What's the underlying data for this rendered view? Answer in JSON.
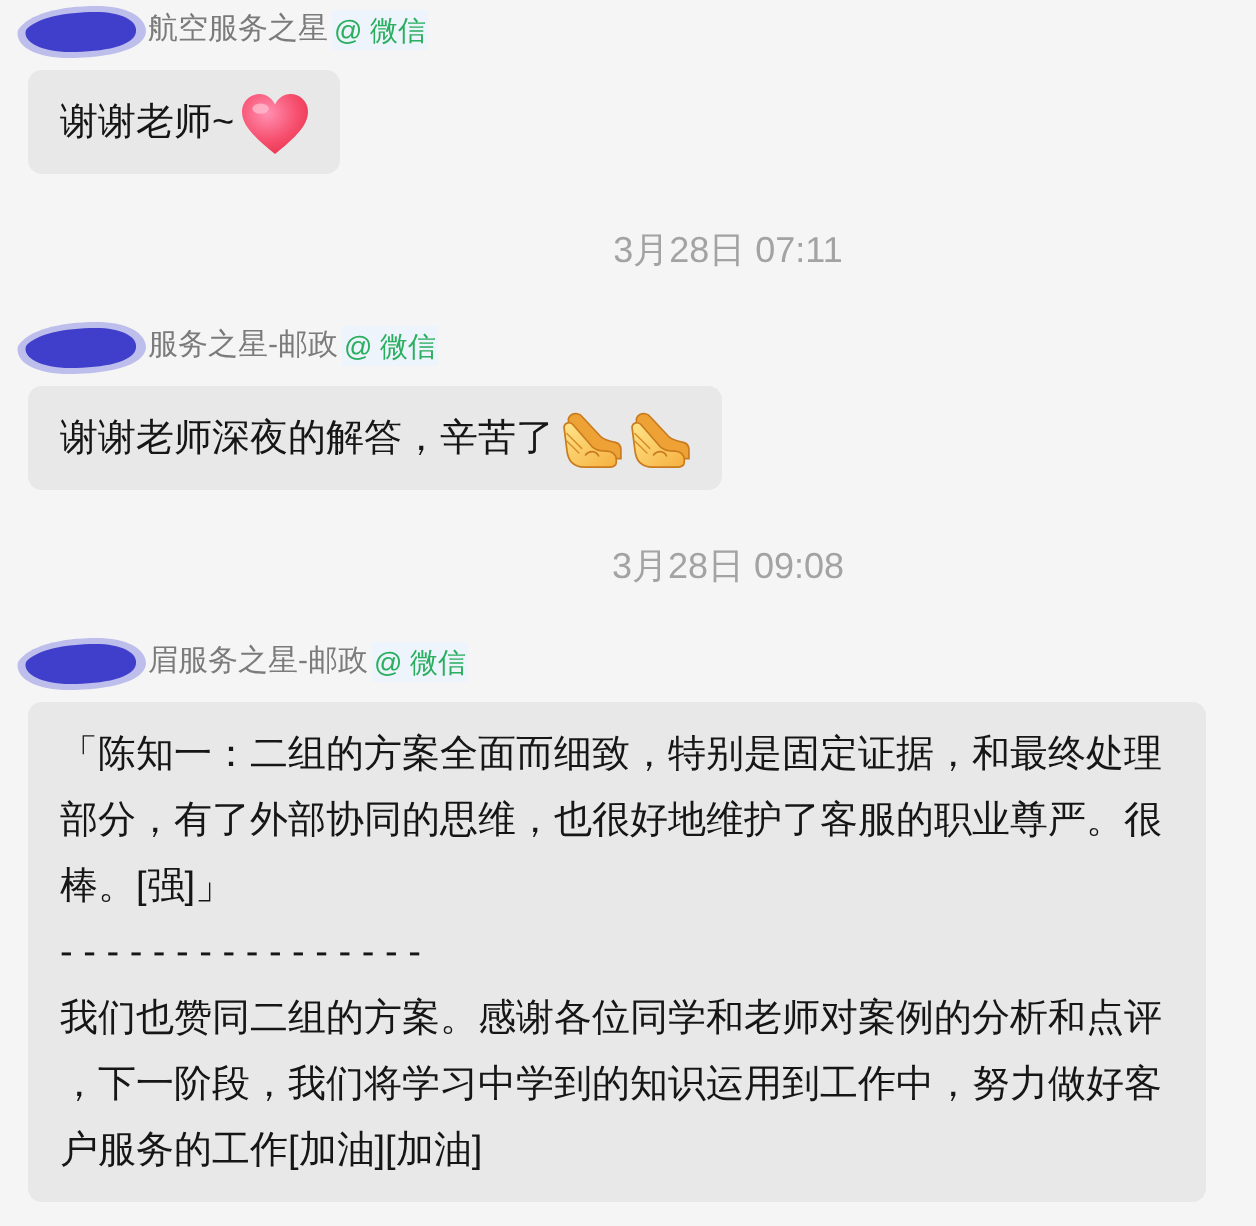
{
  "messages": [
    {
      "kind": "message",
      "sender": {
        "name": "航空服务之星",
        "redacted": true,
        "source": "@ 微信"
      },
      "paragraphs": [
        "谢谢老师~"
      ],
      "emojis": [
        {
          "kind": "heart"
        }
      ]
    },
    {
      "kind": "timestamp",
      "text": "3月28日 07:11"
    },
    {
      "kind": "message",
      "sender": {
        "name": "服务之星-邮政",
        "redacted": true,
        "source": "@ 微信"
      },
      "paragraphs": [
        "谢谢老师深夜的解答，辛苦了"
      ],
      "emojis": [
        {
          "kind": "pray"
        },
        {
          "kind": "pray"
        }
      ]
    },
    {
      "kind": "timestamp",
      "text": "3月28日 09:08"
    },
    {
      "kind": "message",
      "sender": {
        "name": "眉服务之星-邮政",
        "redacted": true,
        "source": "@ 微信"
      },
      "paragraphs": [
        "「陈知一：二组的方案全面而细致，特别是固定证据，和最终处理部分，有了外部协同的思维，也很好地维护了客服的职业尊严。很棒。[强]」",
        "- - - - - - - - - - - - - - - -",
        "我们也赞同二组的方案。感谢各位同学和老师对案例的分析和点评，下一阶段，我们将学习中学到的知识运用到工作中，努力做好客户服务的工作[加油][加油]"
      ]
    }
  ]
}
